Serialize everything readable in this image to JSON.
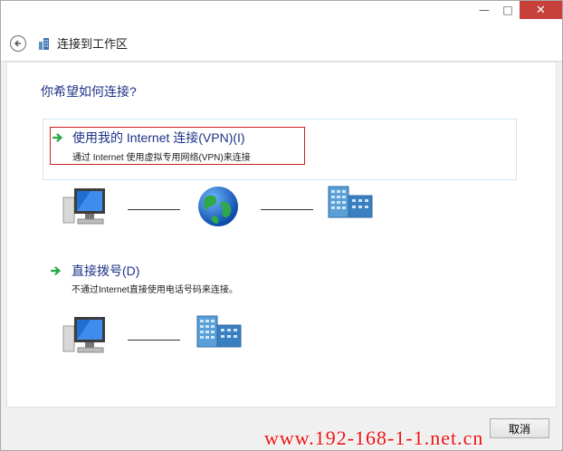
{
  "window": {
    "title_buttons": {
      "minimize": "—",
      "maximize": "□",
      "close": "✕"
    }
  },
  "nav": {
    "back_icon": "back-arrow-icon",
    "title": "连接到工作区"
  },
  "main": {
    "question": "你希望如何连接?",
    "options": [
      {
        "title": "使用我的 Internet 连接(VPN)(I)",
        "description": "通过 Internet 使用虚拟专用网络(VPN)来连接",
        "icon": "green-arrow-icon",
        "selected": true
      },
      {
        "title": "直接拨号(D)",
        "description": "不通过Internet直接使用电话号码来连接。",
        "icon": "green-arrow-icon",
        "selected": false
      }
    ]
  },
  "footer": {
    "cancel_label": "取消"
  },
  "watermark": "www.192-168-1-1.net.cn",
  "colors": {
    "accent": "#1e3287",
    "highlight_border": "#cc1f1f",
    "close_button": "#c7413a",
    "watermark": "#ee1111"
  }
}
